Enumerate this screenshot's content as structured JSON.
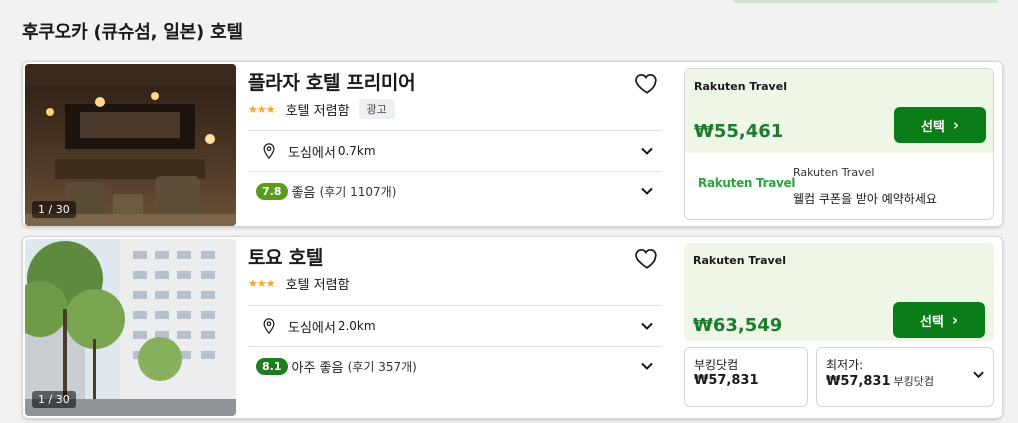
{
  "page": {
    "title": "후쿠오카 (큐슈섬, 일본) 호텔"
  },
  "hotels": [
    {
      "name": "플라자 호텔 프리미어",
      "stars": "★★★",
      "category": "호텔 저렴함",
      "ad_label": "광고",
      "photo_counter": "1 / 30",
      "distance_prefix": "도심에서",
      "distance": "0.7km",
      "rating": "7.8",
      "rating_text": "좋음",
      "review_text": "(후기 1107개)",
      "provider": "Rakuten Travel",
      "price": "₩55,461",
      "select_label": "선택",
      "partner_logo": "Rakuten Travel",
      "partner_name": "Rakuten Travel",
      "partner_promo": "웰컴 쿠폰을 받아 예약하세요"
    },
    {
      "name": "토요 호텔",
      "stars": "★★★",
      "category": "호텔 저렴함",
      "photo_counter": "1 / 30",
      "distance_prefix": "도심에서",
      "distance": "2.0km",
      "rating": "8.1",
      "rating_text": "아주 좋음",
      "review_text": "(후기 357개)",
      "provider": "Rakuten Travel",
      "price": "₩63,549",
      "select_label": "선택",
      "alt_deal": {
        "label": "부킹닷컴",
        "price": "₩57,831"
      },
      "lowest_deal": {
        "label": "최저가:",
        "price": "₩57,831",
        "source": "부킹닷컴"
      }
    }
  ],
  "colors": {
    "accent_green": "#0a7d19",
    "price_green": "#1e7b2c",
    "star": "#f5a623",
    "deal_bg": "#eef6e8"
  },
  "icons": [
    "heart-icon",
    "location-pin-icon",
    "chevron-down-icon",
    "chevron-right-icon"
  ]
}
